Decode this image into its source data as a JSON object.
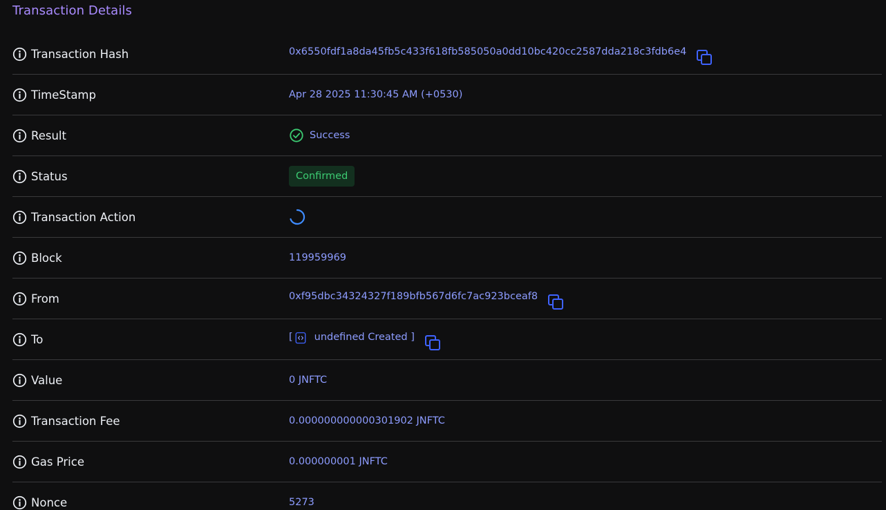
{
  "page_title": "Transaction Details",
  "colors": {
    "background": "#0f0f10",
    "title": "#a98bff",
    "value": "#8d9cff",
    "success": "#3ccb72",
    "badge_bg": "#13301f",
    "copy_icon": "#3f63ff",
    "divider": "#3a3a3c"
  },
  "rows": {
    "hash": {
      "label": "Transaction Hash",
      "value": "0x6550fdf1a8da45fb5c433f618fb585050a0dd10bc420cc2587dda218c3fdb6e4",
      "icon": "copy-icon"
    },
    "timestamp": {
      "label": "TimeStamp",
      "value": "Apr 28 2025 11:30:45 AM (+0530)"
    },
    "result": {
      "label": "Result",
      "value": "Success",
      "icon": "check-circle-icon"
    },
    "status": {
      "label": "Status",
      "value": "Confirmed"
    },
    "action": {
      "label": "Transaction Action",
      "icon": "loading-spinner-icon"
    },
    "block": {
      "label": "Block",
      "value": "119959969"
    },
    "from": {
      "label": "From",
      "value": "0xf95dbc34324327f189bfb567d6fc7ac923bceaf8",
      "icon": "copy-icon"
    },
    "to": {
      "label": "To",
      "open_bracket": "[",
      "value": "undefined Created ]",
      "icon": "contract-code-icon"
    },
    "value": {
      "label": "Value",
      "value": "0 JNFTC"
    },
    "fee": {
      "label": "Transaction Fee",
      "value": "0.000000000000301902 JNFTC"
    },
    "gas_price": {
      "label": "Gas Price",
      "value": "0.000000001 JNFTC"
    },
    "nonce": {
      "label": "Nonce",
      "value": "5273"
    }
  }
}
